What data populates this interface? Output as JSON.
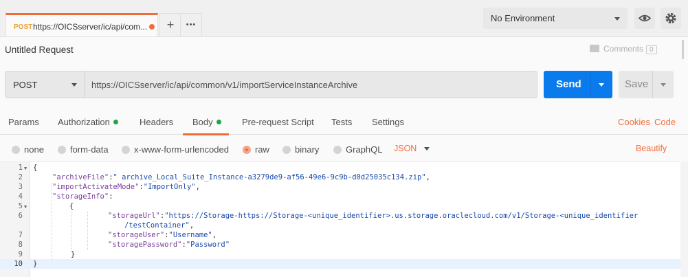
{
  "tab": {
    "method": "POST",
    "url": "https://OICSserver/ic/api/com..."
  },
  "tab_buttons": {
    "new": "+",
    "more": "•••"
  },
  "environment": {
    "label": "No Environment"
  },
  "request": {
    "title": "Untitled Request",
    "method": "POST",
    "url": "https://OICSserver/ic/api/common/v1/importServiceInstanceArchive"
  },
  "comments": {
    "label": "Comments",
    "count": "0"
  },
  "buttons": {
    "send": "Send",
    "save": "Save"
  },
  "subtabs": [
    "Params",
    "Authorization",
    "Headers",
    "Body",
    "Pre-request Script",
    "Tests",
    "Settings"
  ],
  "subtabs_active": "Body",
  "right_links": {
    "cookies": "Cookies",
    "code": "Code"
  },
  "body_modes": [
    "none",
    "form-data",
    "x-www-form-urlencoded",
    "raw",
    "binary",
    "GraphQL"
  ],
  "body_mode_selected": "raw",
  "format": "JSON",
  "beautify": "Beautify",
  "colors": {
    "accent": "#f26b3a",
    "send": "#097bed",
    "status_dot": "#22a34a"
  },
  "editor": {
    "line_numbers": [
      "1",
      "2",
      "3",
      "4",
      "5",
      "6",
      "",
      "7",
      "8",
      "9",
      "10"
    ],
    "lines": {
      "l1": "{",
      "l2k": "\"archiveFile\"",
      "l2v": "\" archive_Local_Suite_Instance-a3279de9-af56-49e6-9c9b-d0d25035c134.zip\"",
      "l3k": "\"importActivateMode\"",
      "l3v": "\"ImportOnly\"",
      "l4k": "\"storageInfo\"",
      "l5": "{",
      "l6k": "\"storageUrl\"",
      "l6v": "\"https://Storage-https://Storage-<unique_identifier>.us.storage.oraclecloud.com/v1/Storage-<unique_identifier",
      "l6w": "/testContainer\"",
      "l7k": "\"storageUser\"",
      "l7v": "\"Username\"",
      "l8k": "\"storagePassword\"",
      "l8v": "\"Password\"",
      "l9": "}",
      "l10": "}"
    }
  }
}
